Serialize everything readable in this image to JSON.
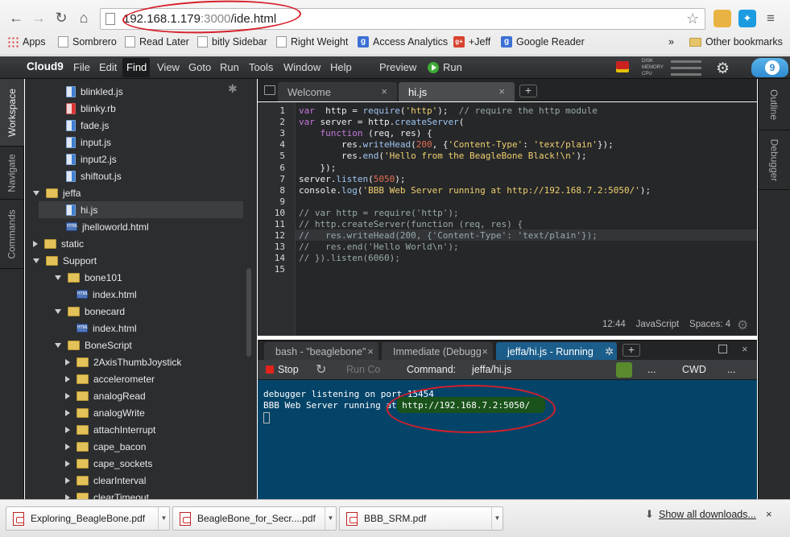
{
  "browser": {
    "url_host": "192.168.1.179",
    "url_port": ":3000",
    "url_path": "/ide.html",
    "bookmarks": [
      {
        "label": "Apps"
      },
      {
        "label": "Sombrero"
      },
      {
        "label": "Read Later"
      },
      {
        "label": "bitly Sidebar"
      },
      {
        "label": "Right Weight"
      },
      {
        "label": "Access Analytics"
      },
      {
        "label": "+Jeff"
      },
      {
        "label": "Google Reader"
      }
    ],
    "more_label": "»",
    "other_bookmarks": "Other bookmarks"
  },
  "menubar": {
    "brand": "Cloud9",
    "items": [
      "File",
      "Edit",
      "Find",
      "View",
      "Goto",
      "Run",
      "Tools",
      "Window",
      "Help"
    ],
    "preview": "Preview",
    "run": "Run",
    "meters": [
      "DISK",
      "MEMORY",
      "CPU"
    ],
    "logo_digit": "9"
  },
  "left_tabs": [
    "Workspace",
    "Navigate",
    "Commands"
  ],
  "right_tabs": [
    "Outline",
    "Debugger"
  ],
  "tree": [
    {
      "label": "blinkled.js",
      "type": "js",
      "depth": 3
    },
    {
      "label": "blinky.rb",
      "type": "rb",
      "depth": 3
    },
    {
      "label": "fade.js",
      "type": "js",
      "depth": 3
    },
    {
      "label": "input.js",
      "type": "js",
      "depth": 3
    },
    {
      "label": "input2.js",
      "type": "js",
      "depth": 3
    },
    {
      "label": "shiftout.js",
      "type": "js",
      "depth": 3
    },
    {
      "label": "jeffa",
      "type": "folder-open",
      "depth": 2
    },
    {
      "label": "hi.js",
      "type": "js",
      "depth": 3,
      "selected": true
    },
    {
      "label": "jhelloworld.html",
      "type": "html",
      "depth": 3
    },
    {
      "label": "static",
      "type": "folder",
      "depth": 2
    },
    {
      "label": "Support",
      "type": "folder-open",
      "depth": 2
    },
    {
      "label": "bone101",
      "type": "folder-open",
      "depth": 3
    },
    {
      "label": "index.html",
      "type": "html",
      "depth": 4
    },
    {
      "label": "bonecard",
      "type": "folder-open",
      "depth": 3
    },
    {
      "label": "index.html",
      "type": "html",
      "depth": 4
    },
    {
      "label": "BoneScript",
      "type": "folder-open",
      "depth": 3
    },
    {
      "label": "2AxisThumbJoystick",
      "type": "folder",
      "depth": 4
    },
    {
      "label": "accelerometer",
      "type": "folder",
      "depth": 4
    },
    {
      "label": "analogRead",
      "type": "folder",
      "depth": 4
    },
    {
      "label": "analogWrite",
      "type": "folder",
      "depth": 4
    },
    {
      "label": "attachInterrupt",
      "type": "folder",
      "depth": 4
    },
    {
      "label": "cape_bacon",
      "type": "folder",
      "depth": 4
    },
    {
      "label": "cape_sockets",
      "type": "folder",
      "depth": 4
    },
    {
      "label": "clearInterval",
      "type": "folder",
      "depth": 4
    },
    {
      "label": "clearTimeout",
      "type": "folder",
      "depth": 4
    }
  ],
  "editor_tabs": [
    {
      "label": "Welcome",
      "close": "×"
    },
    {
      "label": "hi.js",
      "close": "×"
    }
  ],
  "add_tab": "+",
  "code_lines": [
    [
      [
        "kw",
        "var"
      ],
      [
        "",
        "  http = "
      ],
      [
        "fn",
        "require"
      ],
      [
        "",
        "("
      ],
      [
        "str",
        "'http'"
      ],
      [
        "",
        ");  "
      ],
      [
        "cm",
        "// require the http module"
      ]
    ],
    [
      [
        "kw",
        "var"
      ],
      [
        "",
        " server = http."
      ],
      [
        "fn",
        "createServer"
      ],
      [
        "",
        "("
      ]
    ],
    [
      [
        "",
        "    "
      ],
      [
        "kw",
        "function"
      ],
      [
        "",
        " (req, res) {"
      ]
    ],
    [
      [
        "",
        "        res."
      ],
      [
        "fn",
        "writeHead"
      ],
      [
        "",
        "("
      ],
      [
        "num",
        "200"
      ],
      [
        "",
        ", {"
      ],
      [
        "str",
        "'Content-Type'"
      ],
      [
        "",
        ": "
      ],
      [
        "str",
        "'text/plain'"
      ],
      [
        "",
        "});"
      ]
    ],
    [
      [
        "",
        "        res."
      ],
      [
        "fn",
        "end"
      ],
      [
        "",
        "("
      ],
      [
        "str",
        "'Hello from the BeagleBone Black!\\n'"
      ],
      [
        "",
        ");"
      ]
    ],
    [
      [
        "",
        "    });"
      ]
    ],
    [
      [
        "",
        "server."
      ],
      [
        "fn",
        "listen"
      ],
      [
        "",
        "("
      ],
      [
        "num",
        "5050"
      ],
      [
        "",
        ");"
      ]
    ],
    [
      [
        "",
        "console."
      ],
      [
        "fn",
        "log"
      ],
      [
        "",
        "("
      ],
      [
        "str",
        "'BBB Web Server running at http://192.168.7.2:5050/'"
      ],
      [
        "",
        ");"
      ]
    ],
    [
      [
        "",
        ""
      ]
    ],
    [
      [
        "cm",
        "// var http = require('http');"
      ]
    ],
    [
      [
        "cm",
        "// http.createServer(function (req, res) {"
      ]
    ],
    [
      [
        "cm",
        "//   res.writeHead(200, {'Content-Type': 'text/plain'});"
      ]
    ],
    [
      [
        "cm",
        "//   res.end('Hello World\\n');"
      ]
    ],
    [
      [
        "cm",
        "// }).listen(6060);"
      ]
    ],
    [
      [
        "",
        ""
      ]
    ]
  ],
  "status": {
    "position": "12:44",
    "mode": "JavaScript",
    "spaces": "Spaces: 4"
  },
  "console_tabs": [
    {
      "label": "bash - \"beaglebone\"",
      "close": "×"
    },
    {
      "label": "Immediate (Debugg",
      "close": "×"
    },
    {
      "label": "jeffa/hi.js - Running",
      "close": "✲"
    }
  ],
  "console_toolbar": {
    "stop": "Stop",
    "run_co": "Run Co",
    "command_label": "Command:",
    "command_value": "jeffa/hi.js",
    "dots1": "...",
    "cwd": "CWD",
    "dots2": "..."
  },
  "console_output": [
    "debugger listening on port 15454",
    "BBB Web Server running at http://192.168.7.2:5050/"
  ],
  "downloads": [
    {
      "label": "Exploring_BeagleBone.pdf"
    },
    {
      "label": "BeagleBone_for_Secr....pdf"
    },
    {
      "label": "BBB_SRM.pdf"
    }
  ],
  "show_all": "Show all downloads...",
  "dl_close": "×",
  "colors": {
    "accent": "#1b5e8c",
    "console_bg": "#044469",
    "annotation": "#d6202a"
  }
}
